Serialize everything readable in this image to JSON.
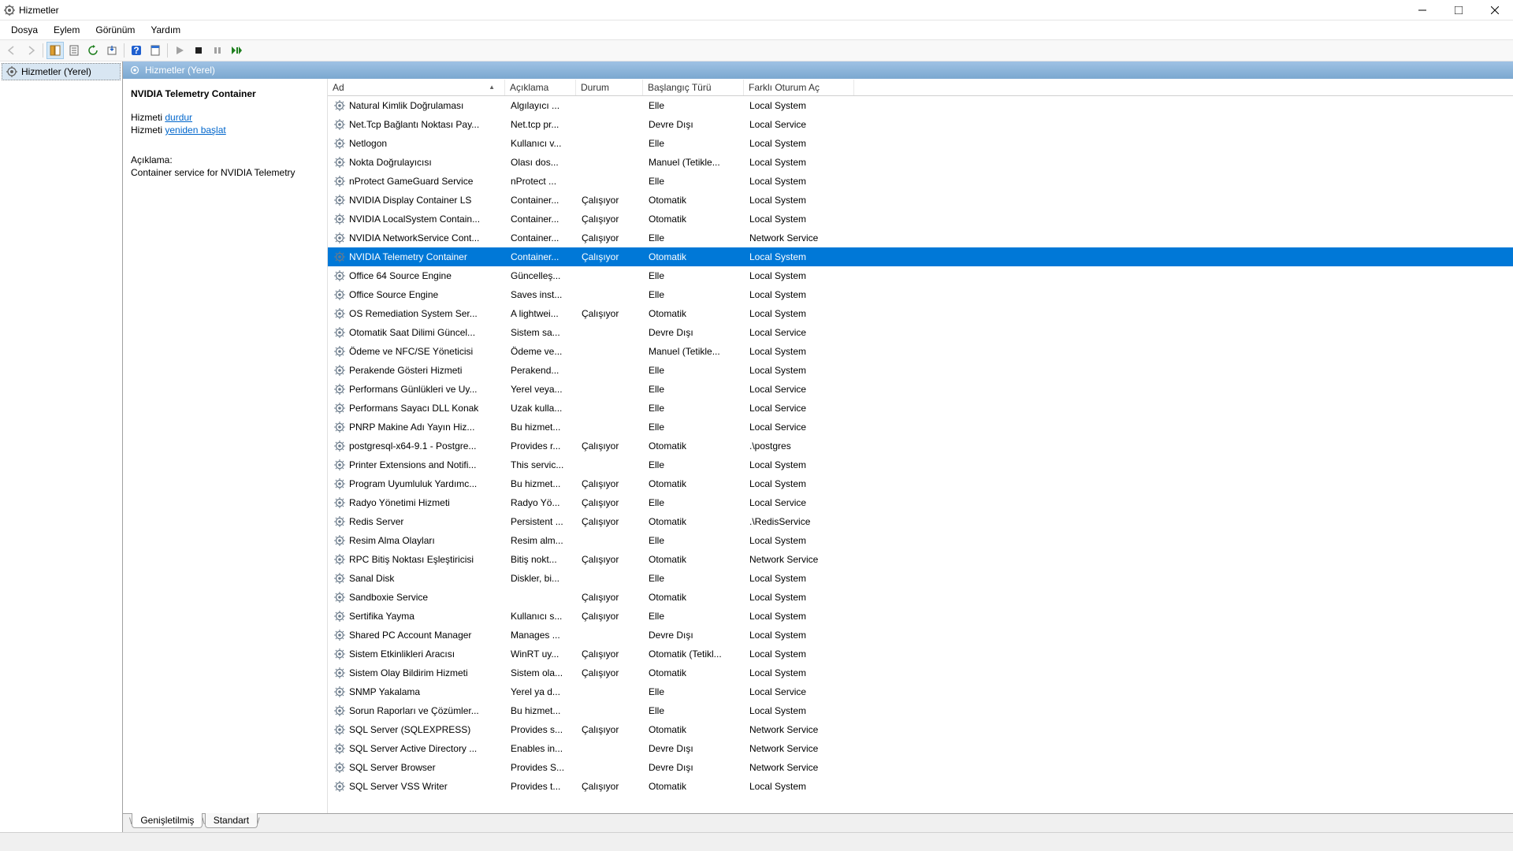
{
  "window": {
    "title": "Hizmetler"
  },
  "menubar": {
    "file": "Dosya",
    "action": "Eylem",
    "view": "Görünüm",
    "help": "Yardım"
  },
  "tree": {
    "root": "Hizmetler (Yerel)"
  },
  "main_header": "Hizmetler (Yerel)",
  "detail": {
    "selected_name": "NVIDIA Telemetry Container",
    "action_prefix": "Hizmeti ",
    "action_stop": "durdur",
    "action_restart": "yeniden başlat",
    "desc_label": "Açıklama:",
    "desc_text": "Container service for NVIDIA Telemetry"
  },
  "columns": {
    "name": "Ad",
    "desc": "Açıklama",
    "status": "Durum",
    "startup": "Başlangıç Türü",
    "logon": "Farklı Oturum Aç"
  },
  "tabs": {
    "extended": "Genişletilmiş",
    "standard": "Standart"
  },
  "services": [
    {
      "name": "Natural Kimlik Doğrulaması",
      "desc": "Algılayıcı ...",
      "status": "",
      "startup": "Elle",
      "logon": "Local System"
    },
    {
      "name": "Net.Tcp Bağlantı Noktası Pay...",
      "desc": "Net.tcp pr...",
      "status": "",
      "startup": "Devre Dışı",
      "logon": "Local Service"
    },
    {
      "name": "Netlogon",
      "desc": "Kullanıcı v...",
      "status": "",
      "startup": "Elle",
      "logon": "Local System"
    },
    {
      "name": "Nokta Doğrulayıcısı",
      "desc": "Olası dos...",
      "status": "",
      "startup": "Manuel (Tetikle...",
      "logon": "Local System"
    },
    {
      "name": "nProtect GameGuard Service",
      "desc": "nProtect ...",
      "status": "",
      "startup": "Elle",
      "logon": "Local System"
    },
    {
      "name": "NVIDIA Display Container LS",
      "desc": "Container...",
      "status": "Çalışıyor",
      "startup": "Otomatik",
      "logon": "Local System"
    },
    {
      "name": "NVIDIA LocalSystem Contain...",
      "desc": "Container...",
      "status": "Çalışıyor",
      "startup": "Otomatik",
      "logon": "Local System"
    },
    {
      "name": "NVIDIA NetworkService Cont...",
      "desc": "Container...",
      "status": "Çalışıyor",
      "startup": "Elle",
      "logon": "Network Service"
    },
    {
      "name": "NVIDIA Telemetry Container",
      "desc": "Container...",
      "status": "Çalışıyor",
      "startup": "Otomatik",
      "logon": "Local System",
      "selected": true
    },
    {
      "name": "Office 64 Source Engine",
      "desc": "Güncelleş...",
      "status": "",
      "startup": "Elle",
      "logon": "Local System"
    },
    {
      "name": "Office Source Engine",
      "desc": "Saves inst...",
      "status": "",
      "startup": "Elle",
      "logon": "Local System"
    },
    {
      "name": "OS Remediation System Ser...",
      "desc": "A lightwei...",
      "status": "Çalışıyor",
      "startup": "Otomatik",
      "logon": "Local System"
    },
    {
      "name": "Otomatik Saat Dilimi Güncel...",
      "desc": "Sistem sa...",
      "status": "",
      "startup": "Devre Dışı",
      "logon": "Local Service"
    },
    {
      "name": "Ödeme ve NFC/SE Yöneticisi",
      "desc": "Ödeme ve...",
      "status": "",
      "startup": "Manuel (Tetikle...",
      "logon": "Local System"
    },
    {
      "name": "Perakende Gösteri Hizmeti",
      "desc": "Perakend...",
      "status": "",
      "startup": "Elle",
      "logon": "Local System"
    },
    {
      "name": "Performans Günlükleri ve Uy...",
      "desc": "Yerel veya...",
      "status": "",
      "startup": "Elle",
      "logon": "Local Service"
    },
    {
      "name": "Performans Sayacı DLL Konak",
      "desc": "Uzak kulla...",
      "status": "",
      "startup": "Elle",
      "logon": "Local Service"
    },
    {
      "name": "PNRP Makine Adı Yayın Hiz...",
      "desc": "Bu hizmet...",
      "status": "",
      "startup": "Elle",
      "logon": "Local Service"
    },
    {
      "name": "postgresql-x64-9.1 - Postgre...",
      "desc": "Provides r...",
      "status": "Çalışıyor",
      "startup": "Otomatik",
      "logon": ".\\postgres"
    },
    {
      "name": "Printer Extensions and Notifi...",
      "desc": "This servic...",
      "status": "",
      "startup": "Elle",
      "logon": "Local System"
    },
    {
      "name": "Program Uyumluluk Yardımc...",
      "desc": "Bu hizmet...",
      "status": "Çalışıyor",
      "startup": "Otomatik",
      "logon": "Local System"
    },
    {
      "name": "Radyo Yönetimi Hizmeti",
      "desc": "Radyo Yö...",
      "status": "Çalışıyor",
      "startup": "Elle",
      "logon": "Local Service"
    },
    {
      "name": "Redis Server",
      "desc": "Persistent ...",
      "status": "Çalışıyor",
      "startup": "Otomatik",
      "logon": ".\\RedisService"
    },
    {
      "name": "Resim Alma Olayları",
      "desc": "Resim alm...",
      "status": "",
      "startup": "Elle",
      "logon": "Local System"
    },
    {
      "name": "RPC Bitiş Noktası Eşleştiricisi",
      "desc": "Bitiş nokt...",
      "status": "Çalışıyor",
      "startup": "Otomatik",
      "logon": "Network Service"
    },
    {
      "name": "Sanal Disk",
      "desc": "Diskler, bi...",
      "status": "",
      "startup": "Elle",
      "logon": "Local System"
    },
    {
      "name": "Sandboxie Service",
      "desc": "",
      "status": "Çalışıyor",
      "startup": "Otomatik",
      "logon": "Local System"
    },
    {
      "name": "Sertifika Yayma",
      "desc": "Kullanıcı s...",
      "status": "Çalışıyor",
      "startup": "Elle",
      "logon": "Local System"
    },
    {
      "name": "Shared PC Account Manager",
      "desc": "Manages ...",
      "status": "",
      "startup": "Devre Dışı",
      "logon": "Local System"
    },
    {
      "name": "Sistem Etkinlikleri Aracısı",
      "desc": "WinRT uy...",
      "status": "Çalışıyor",
      "startup": "Otomatik (Tetikl...",
      "logon": "Local System"
    },
    {
      "name": "Sistem Olay Bildirim Hizmeti",
      "desc": "Sistem ola...",
      "status": "Çalışıyor",
      "startup": "Otomatik",
      "logon": "Local System"
    },
    {
      "name": "SNMP Yakalama",
      "desc": "Yerel ya d...",
      "status": "",
      "startup": "Elle",
      "logon": "Local Service"
    },
    {
      "name": "Sorun Raporları ve Çözümler...",
      "desc": "Bu hizmet...",
      "status": "",
      "startup": "Elle",
      "logon": "Local System"
    },
    {
      "name": "SQL Server (SQLEXPRESS)",
      "desc": "Provides s...",
      "status": "Çalışıyor",
      "startup": "Otomatik",
      "logon": "Network Service"
    },
    {
      "name": "SQL Server Active Directory ...",
      "desc": "Enables in...",
      "status": "",
      "startup": "Devre Dışı",
      "logon": "Network Service"
    },
    {
      "name": "SQL Server Browser",
      "desc": "Provides S...",
      "status": "",
      "startup": "Devre Dışı",
      "logon": "Network Service"
    },
    {
      "name": "SQL Server VSS Writer",
      "desc": "Provides t...",
      "status": "Çalışıyor",
      "startup": "Otomatik",
      "logon": "Local System"
    }
  ]
}
